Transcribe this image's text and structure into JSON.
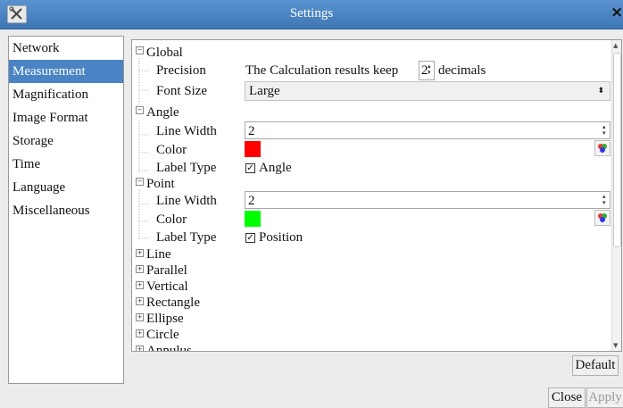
{
  "window": {
    "title": "Settings",
    "close_glyph": "×"
  },
  "sidebar": {
    "items": [
      {
        "label": "Network"
      },
      {
        "label": "Measurement"
      },
      {
        "label": "Magnification"
      },
      {
        "label": "Image Format"
      },
      {
        "label": "Storage"
      },
      {
        "label": "Time"
      },
      {
        "label": "Language"
      },
      {
        "label": "Miscellaneous"
      }
    ],
    "selected": "Measurement"
  },
  "tree": {
    "global": {
      "label": "Global",
      "precision_label": "Precision",
      "precision_prefix": "The Calculation results keep",
      "precision_value": "2",
      "precision_suffix": "decimals",
      "font_size_label": "Font Size",
      "font_size_value": "Large"
    },
    "angle": {
      "label": "Angle",
      "line_width_label": "Line Width",
      "line_width_value": "2",
      "color_label": "Color",
      "color_value": "#ff0000",
      "label_type_label": "Label Type",
      "label_type_value": "Angle",
      "label_type_checked": true
    },
    "point": {
      "label": "Point",
      "line_width_label": "Line Width",
      "line_width_value": "2",
      "color_label": "Color",
      "color_value": "#00ff00",
      "label_type_label": "Label Type",
      "label_type_value": "Position",
      "label_type_checked": true
    },
    "collapsed": [
      {
        "label": "Line"
      },
      {
        "label": "Parallel"
      },
      {
        "label": "Vertical"
      },
      {
        "label": "Rectangle"
      },
      {
        "label": "Ellipse"
      },
      {
        "label": "Circle"
      },
      {
        "label": "Annulus"
      }
    ]
  },
  "buttons": {
    "default_label": "Default",
    "close_label": "Close",
    "apply_label": "Apply"
  },
  "icons": {
    "app": "settings-tools-icon",
    "color_picker": "color-palette-icon"
  }
}
